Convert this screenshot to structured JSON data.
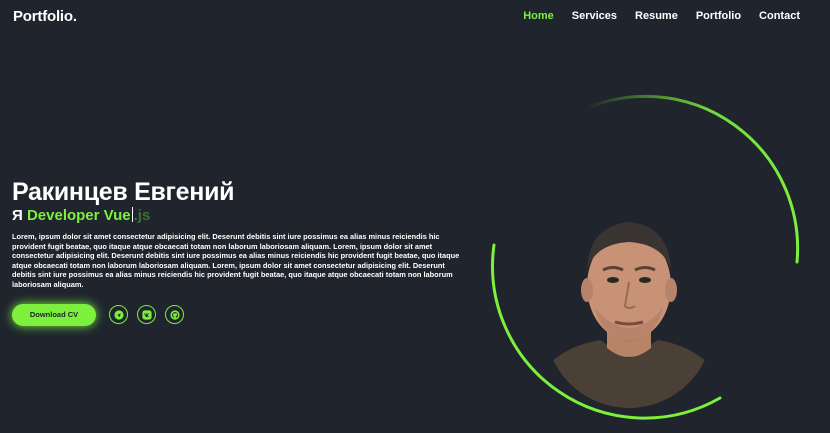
{
  "header": {
    "logo": "Portfolio.",
    "nav": [
      {
        "label": "Home",
        "active": true
      },
      {
        "label": "Services",
        "active": false
      },
      {
        "label": "Resume",
        "active": false
      },
      {
        "label": "Portfolio",
        "active": false
      },
      {
        "label": "Contact",
        "active": false
      }
    ]
  },
  "hero": {
    "name": "Ракинцев Евгений",
    "role_prefix": "Я",
    "role_typed": "Developer Vue",
    "role_rest": ".js",
    "description": "Lorem, ipsum dolor sit amet consectetur adipisicing elit. Deserunt debitis sint iure possimus ea alias minus reiciendis hic provident fugit beatae, quo itaque atque obcaecati totam non laborum laboriosam aliquam. Lorem, ipsum dolor sit amet consectetur adipisicing elit. Deserunt debitis sint iure possimus ea alias minus reiciendis hic provident fugit beatae, quo itaque atque obcaecati totam non laborum laboriosam aliquam. Lorem, ipsum dolor sit amet consectetur adipisicing elit. Deserunt debitis sint iure possimus ea alias minus reiciendis hic provident fugit beatae, quo itaque atque obcaecati totam non laborum laboriosam aliquam.",
    "download_label": "Download CV",
    "socials": [
      "telegram-icon",
      "vk-icon",
      "github-icon"
    ]
  },
  "colors": {
    "background": "#1f242d",
    "accent": "#7cf03d",
    "text": "#ffffff"
  }
}
